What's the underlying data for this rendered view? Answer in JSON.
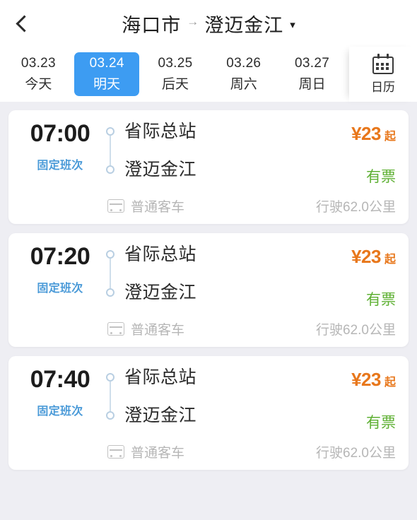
{
  "header": {
    "back_icon": "chevron-left-icon",
    "origin": "海口市",
    "arrow": "→",
    "destination": "澄迈金江",
    "caret": "▾"
  },
  "datebar": {
    "dates": [
      {
        "date": "03.23",
        "label": "今天",
        "active": false
      },
      {
        "date": "03.24",
        "label": "明天",
        "active": true
      },
      {
        "date": "03.25",
        "label": "后天",
        "active": false
      },
      {
        "date": "03.26",
        "label": "周六",
        "active": false
      },
      {
        "date": "03.27",
        "label": "周日",
        "active": false
      }
    ],
    "calendar": {
      "icon": "calendar-icon",
      "label": "日历"
    },
    "active_color": "#3d9cf2"
  },
  "trips": [
    {
      "time": "07:00",
      "tag": "固定班次",
      "from": "省际总站",
      "to": "澄迈金江",
      "price_amount": "¥23",
      "price_suffix": "起",
      "ticket_status": "有票",
      "bus_type": "普通客车",
      "distance": "行驶62.0公里"
    },
    {
      "time": "07:20",
      "tag": "固定班次",
      "from": "省际总站",
      "to": "澄迈金江",
      "price_amount": "¥23",
      "price_suffix": "起",
      "ticket_status": "有票",
      "bus_type": "普通客车",
      "distance": "行驶62.0公里"
    },
    {
      "time": "07:40",
      "tag": "固定班次",
      "from": "省际总站",
      "to": "澄迈金江",
      "price_amount": "¥23",
      "price_suffix": "起",
      "ticket_status": "有票",
      "bus_type": "普通客车",
      "distance": "行驶62.0公里"
    }
  ],
  "colors": {
    "price": "#e8771b",
    "ticket": "#5eb033",
    "tag": "#4a9ad8",
    "page_bg": "#eeeef3"
  }
}
